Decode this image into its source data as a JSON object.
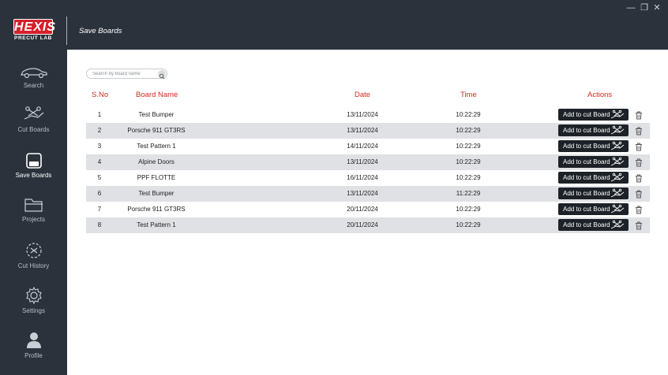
{
  "app": {
    "logo_text": "HEXIS",
    "logo_sub": "PRECUT LAB",
    "page_title": "Save Boards"
  },
  "window": {
    "minimize": "—",
    "restore": "❐",
    "close": "✕"
  },
  "sidebar": {
    "items": [
      {
        "label": "Search",
        "icon": "car-icon"
      },
      {
        "label": "Cut Boards",
        "icon": "cut-boards-icon"
      },
      {
        "label": "Save Boards",
        "icon": "save-boards-icon",
        "active": true
      },
      {
        "label": "Projects",
        "icon": "folder-icon"
      },
      {
        "label": "Cut History",
        "icon": "cut-history-icon"
      },
      {
        "label": "Settings",
        "icon": "gear-icon"
      },
      {
        "label": "Profile",
        "icon": "user-icon"
      }
    ]
  },
  "search": {
    "placeholder": "Search by board name",
    "icon": "search-icon"
  },
  "table": {
    "headers": {
      "sno": "S.No",
      "name": "Board Name",
      "date": "Date",
      "time": "Time",
      "actions": "Actions"
    },
    "action_label": "Add to cut Board",
    "rows": [
      {
        "sno": "1",
        "name": "Test Bumper",
        "date": "13/11/2024",
        "time": "10:22:29"
      },
      {
        "sno": "2",
        "name": "Porsche 911 GT3RS",
        "date": "13/11/2024",
        "time": "10:22:29"
      },
      {
        "sno": "3",
        "name": "Test Pattern 1",
        "date": "14/11/2024",
        "time": "10:22:29"
      },
      {
        "sno": "4",
        "name": "Alpine Doors",
        "date": "13/11/2024",
        "time": "10:22:29"
      },
      {
        "sno": "5",
        "name": "PPF FLOTTE",
        "date": "16/11/2024",
        "time": "10:22:29"
      },
      {
        "sno": "6",
        "name": "Test Bumper",
        "date": "13/11/2024",
        "time": "11:22:29"
      },
      {
        "sno": "7",
        "name": "Porsche 911 GT3RS",
        "date": "20/11/2024",
        "time": "10:22:29"
      },
      {
        "sno": "8",
        "name": "Test Pattern 1",
        "date": "20/11/2024",
        "time": "10:22:29"
      }
    ]
  },
  "colors": {
    "sidebar_bg": "#2b323b",
    "accent_red": "#d32a1f",
    "row_alt": "#dfe1e4",
    "button_bg": "#1d2228"
  }
}
